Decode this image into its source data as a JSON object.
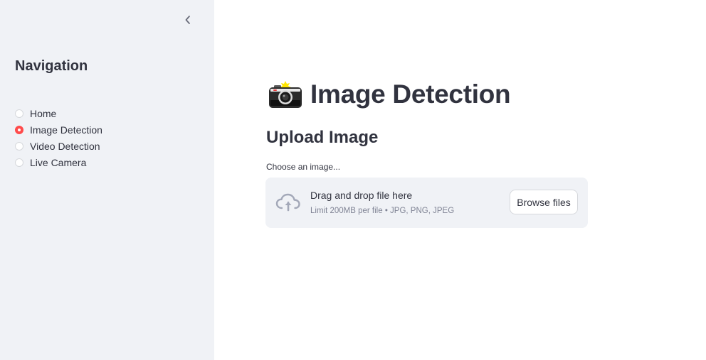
{
  "sidebar": {
    "collapse_icon": "chevron-left-icon",
    "title": "Navigation",
    "items": [
      {
        "label": "Home",
        "selected": false
      },
      {
        "label": "Image Detection",
        "selected": true
      },
      {
        "label": "Video Detection",
        "selected": false
      },
      {
        "label": "Live Camera",
        "selected": false
      }
    ]
  },
  "main": {
    "title_icon": "camera-flash-icon",
    "title": "Image Detection",
    "section_title": "Upload Image",
    "uploader": {
      "label": "Choose an image...",
      "icon": "cloud-upload-icon",
      "primary_text": "Drag and drop file here",
      "secondary_text": "Limit 200MB per file • JPG, PNG, JPEG",
      "button_label": "Browse files"
    }
  },
  "colors": {
    "sidebar_bg": "#f0f2f6",
    "accent": "#ff4b4b",
    "text": "#31333f",
    "muted": "#808495"
  }
}
